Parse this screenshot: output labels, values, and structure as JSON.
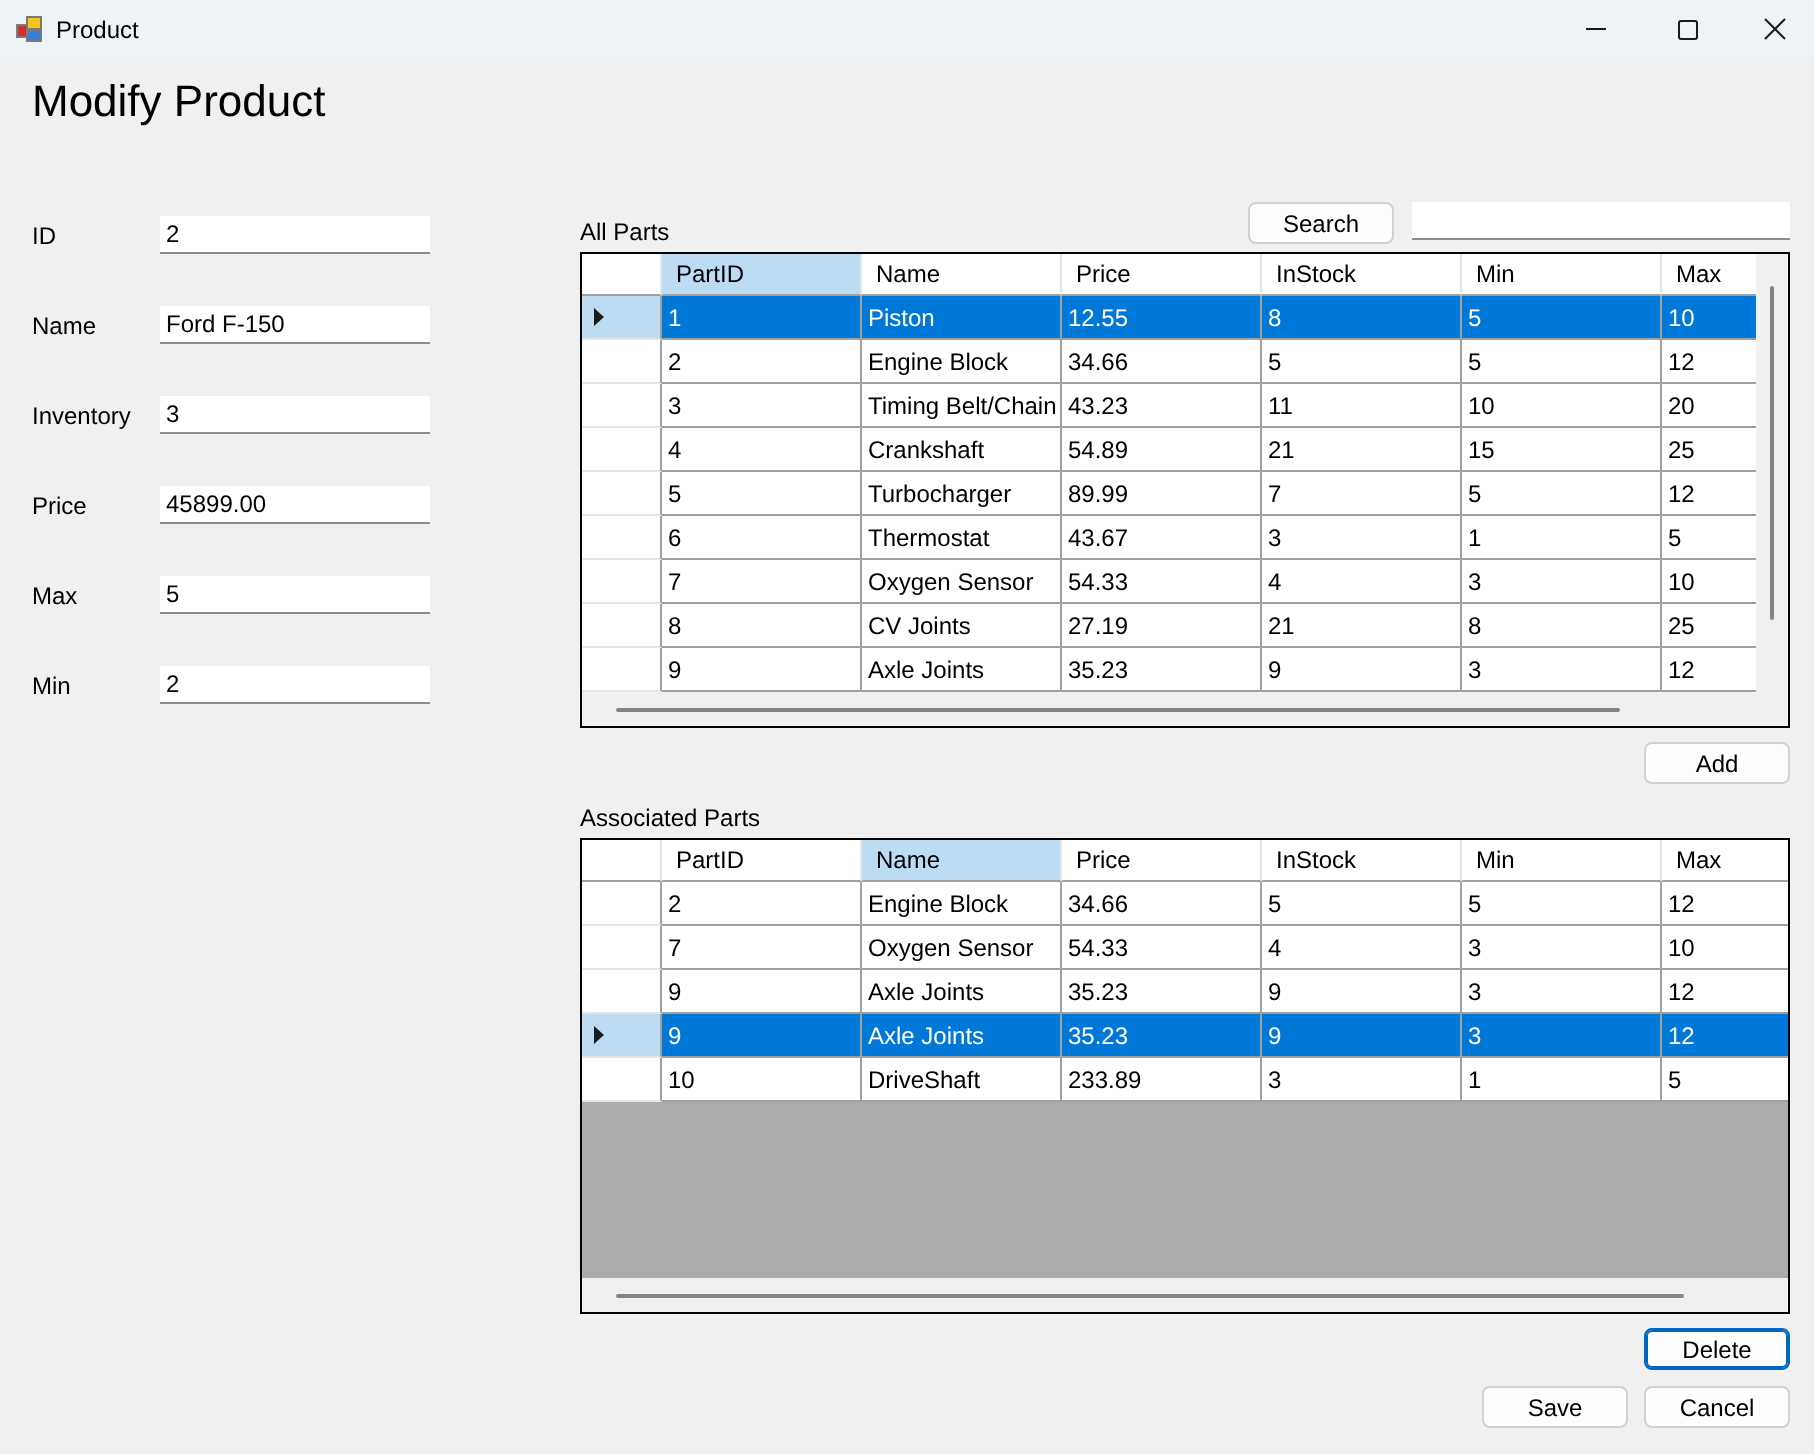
{
  "window": {
    "title": "Product"
  },
  "heading": "Modify Product",
  "fields": [
    {
      "label": "ID",
      "value": "2"
    },
    {
      "label": "Name",
      "value": "Ford F-150"
    },
    {
      "label": "Inventory",
      "value": "3"
    },
    {
      "label": "Price",
      "value": "45899.00"
    },
    {
      "label": "Max",
      "value": "5"
    },
    {
      "label": "Min",
      "value": "2"
    }
  ],
  "all_parts": {
    "label": "All Parts",
    "search_button": {
      "label": "Search",
      "focused": false
    },
    "columns": [
      {
        "label": "PartID",
        "selected": true
      },
      {
        "label": "Name",
        "selected": false
      },
      {
        "label": "Price",
        "selected": false
      },
      {
        "label": "InStock",
        "selected": false
      },
      {
        "label": "Min",
        "selected": false
      },
      {
        "label": "Max",
        "selected": false
      }
    ],
    "rows": [
      {
        "cells": [
          "1",
          "Piston",
          "12.55",
          "8",
          "5",
          "10"
        ],
        "selected": true
      },
      {
        "cells": [
          "2",
          "Engine Block",
          "34.66",
          "5",
          "5",
          "12"
        ],
        "selected": false
      },
      {
        "cells": [
          "3",
          "Timing Belt/Chain",
          "43.23",
          "11",
          "10",
          "20"
        ],
        "selected": false
      },
      {
        "cells": [
          "4",
          "Crankshaft",
          "54.89",
          "21",
          "15",
          "25"
        ],
        "selected": false
      },
      {
        "cells": [
          "5",
          "Turbocharger",
          "89.99",
          "7",
          "5",
          "12"
        ],
        "selected": false
      },
      {
        "cells": [
          "6",
          "Thermostat",
          "43.67",
          "3",
          "1",
          "5"
        ],
        "selected": false
      },
      {
        "cells": [
          "7",
          "Oxygen Sensor",
          "54.33",
          "4",
          "3",
          "10"
        ],
        "selected": false
      },
      {
        "cells": [
          "8",
          "CV Joints",
          "27.19",
          "21",
          "8",
          "25"
        ],
        "selected": false
      },
      {
        "cells": [
          "9",
          "Axle Joints",
          "35.23",
          "9",
          "3",
          "12"
        ],
        "selected": false
      }
    ],
    "add_button": {
      "label": "Add",
      "focused": false
    }
  },
  "associated_parts": {
    "label": "Associated Parts",
    "columns": [
      {
        "label": "PartID",
        "selected": false
      },
      {
        "label": "Name",
        "selected": true
      },
      {
        "label": "Price",
        "selected": false
      },
      {
        "label": "InStock",
        "selected": false
      },
      {
        "label": "Min",
        "selected": false
      },
      {
        "label": "Max",
        "selected": false
      }
    ],
    "rows": [
      {
        "cells": [
          "2",
          "Engine Block",
          "34.66",
          "5",
          "5",
          "12"
        ],
        "selected": false
      },
      {
        "cells": [
          "7",
          "Oxygen Sensor",
          "54.33",
          "4",
          "3",
          "10"
        ],
        "selected": false
      },
      {
        "cells": [
          "9",
          "Axle Joints",
          "35.23",
          "9",
          "3",
          "12"
        ],
        "selected": false
      },
      {
        "cells": [
          "9",
          "Axle Joints",
          "35.23",
          "9",
          "3",
          "12"
        ],
        "selected": true
      },
      {
        "cells": [
          "10",
          "DriveShaft",
          "233.89",
          "3",
          "1",
          "5"
        ],
        "selected": false
      }
    ],
    "delete_button": {
      "label": "Delete",
      "focused": true
    }
  },
  "save_button": {
    "label": "Save",
    "focused": false
  },
  "cancel_button": {
    "label": "Cancel",
    "focused": false
  }
}
